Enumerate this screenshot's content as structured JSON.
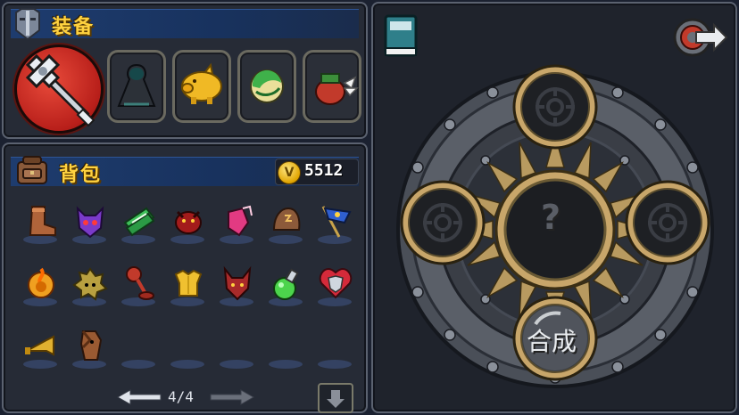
{
  "equipment": {
    "title": "装备",
    "slots": [
      {
        "name": "hammer-weapon-icon",
        "selected": true
      },
      {
        "name": "dark-cloak-icon"
      },
      {
        "name": "golden-pig-icon"
      },
      {
        "name": "green-orb-icon"
      },
      {
        "name": "winged-pot-icon"
      }
    ]
  },
  "backpack": {
    "title": "背包",
    "currency": {
      "icon": "v-coin-icon",
      "symbol": "V",
      "value": "5512"
    },
    "items": [
      "boot-icon",
      "purple-demon-mask-icon",
      "cash-stack-icon",
      "red-beetle-icon",
      "pink-gauntlet-icon",
      "rune-stone-icon",
      "blue-flag-icon",
      "fire-shield-icon",
      "spiky-beast-icon",
      "plunger-icon",
      "gold-armor-icon",
      "red-wolf-icon",
      "green-potion-icon",
      "heart-shield-icon",
      "horn-icon",
      "horse-mask-icon"
    ],
    "page": "4/4"
  },
  "synthesis": {
    "center_symbol": "?",
    "bottom_label": "合成",
    "book_icon": "recipe-book-icon",
    "exit_icon": "exit-arrow-icon"
  },
  "colors": {
    "title_gold": "#ffd23f",
    "header_blue": "#1e3c6e",
    "panel_bg": "#262b36"
  }
}
